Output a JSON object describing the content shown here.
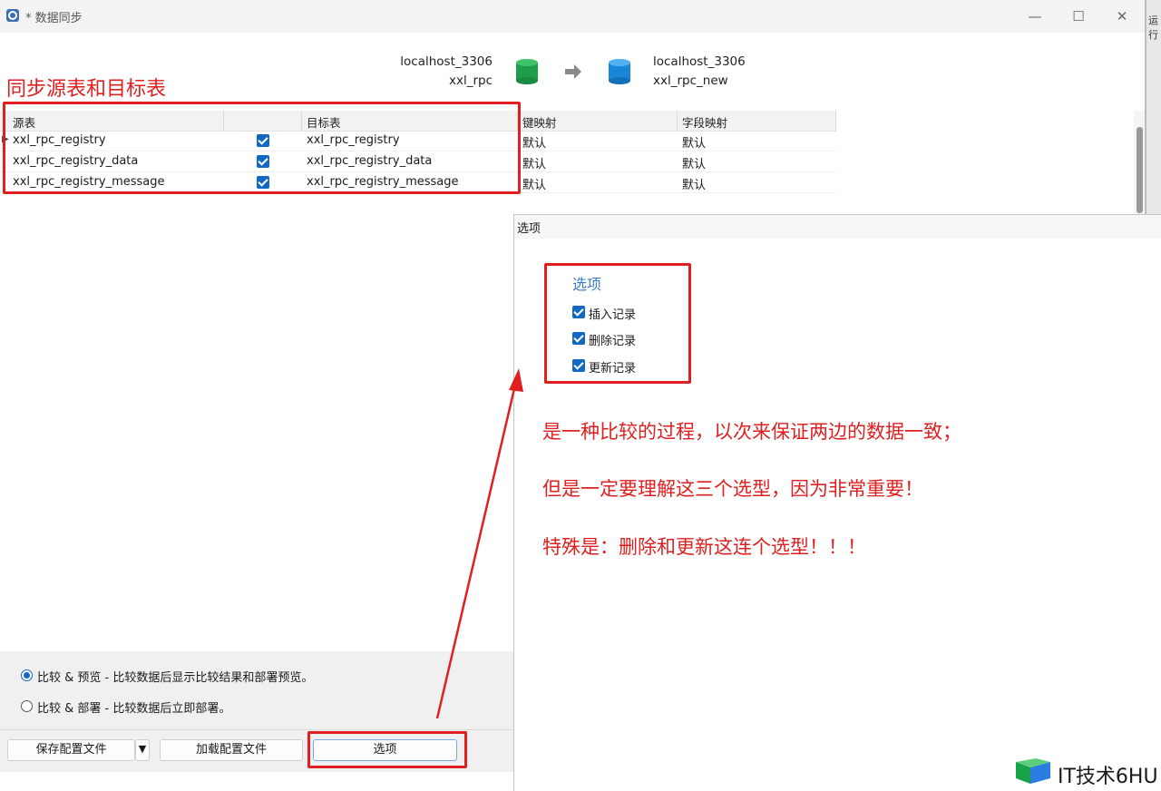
{
  "window": {
    "title": "* 数据同步",
    "minimize_glyph": "—",
    "maximize_glyph": "☐",
    "close_glyph": "✕"
  },
  "connections": {
    "source": {
      "host": "localhost_3306",
      "db": "xxl_rpc",
      "color": "#1e9e4a"
    },
    "target": {
      "host": "localhost_3306",
      "db": "xxl_rpc_new",
      "color": "#1a86d8"
    }
  },
  "table": {
    "headers": {
      "source": "源表",
      "target": "目标表",
      "key_map": "键映射",
      "field_map": "字段映射"
    },
    "rows": [
      {
        "source": "xxl_rpc_registry",
        "target": "xxl_rpc_registry",
        "key_map": "默认",
        "field_map": "默认",
        "checked": true
      },
      {
        "source": "xxl_rpc_registry_data",
        "target": "xxl_rpc_registry_data",
        "key_map": "默认",
        "field_map": "默认",
        "checked": true
      },
      {
        "source": "xxl_rpc_registry_message",
        "target": "xxl_rpc_registry_message",
        "key_map": "默认",
        "field_map": "默认",
        "checked": true
      }
    ]
  },
  "mode": {
    "compare_preview": "比较 & 预览 - 比较数据后显示比较结果和部署预览。",
    "compare_deploy": "比较 & 部署 - 比较数据后立即部署。",
    "selected": "compare_preview"
  },
  "buttons": {
    "save_config": "保存配置文件",
    "load_config": "加载配置文件",
    "options": "选项"
  },
  "options_dialog": {
    "title": "选项",
    "group_title": "选项",
    "items": [
      {
        "label": "插入记录",
        "checked": true
      },
      {
        "label": "删除记录",
        "checked": true
      },
      {
        "label": "更新记录",
        "checked": true
      }
    ]
  },
  "annotations": {
    "table_note": "同步源表和目标表",
    "line1": "是一种比较的过程，以次来保证两边的数据一致；",
    "line2": "但是一定要理解这三个选型，因为非常重要！",
    "line3": "特殊是：删除和更新这连个选型！！！",
    "color": "#e02020"
  },
  "watermark": {
    "text": "IT技术6HU"
  },
  "edge_fragment": "运行"
}
